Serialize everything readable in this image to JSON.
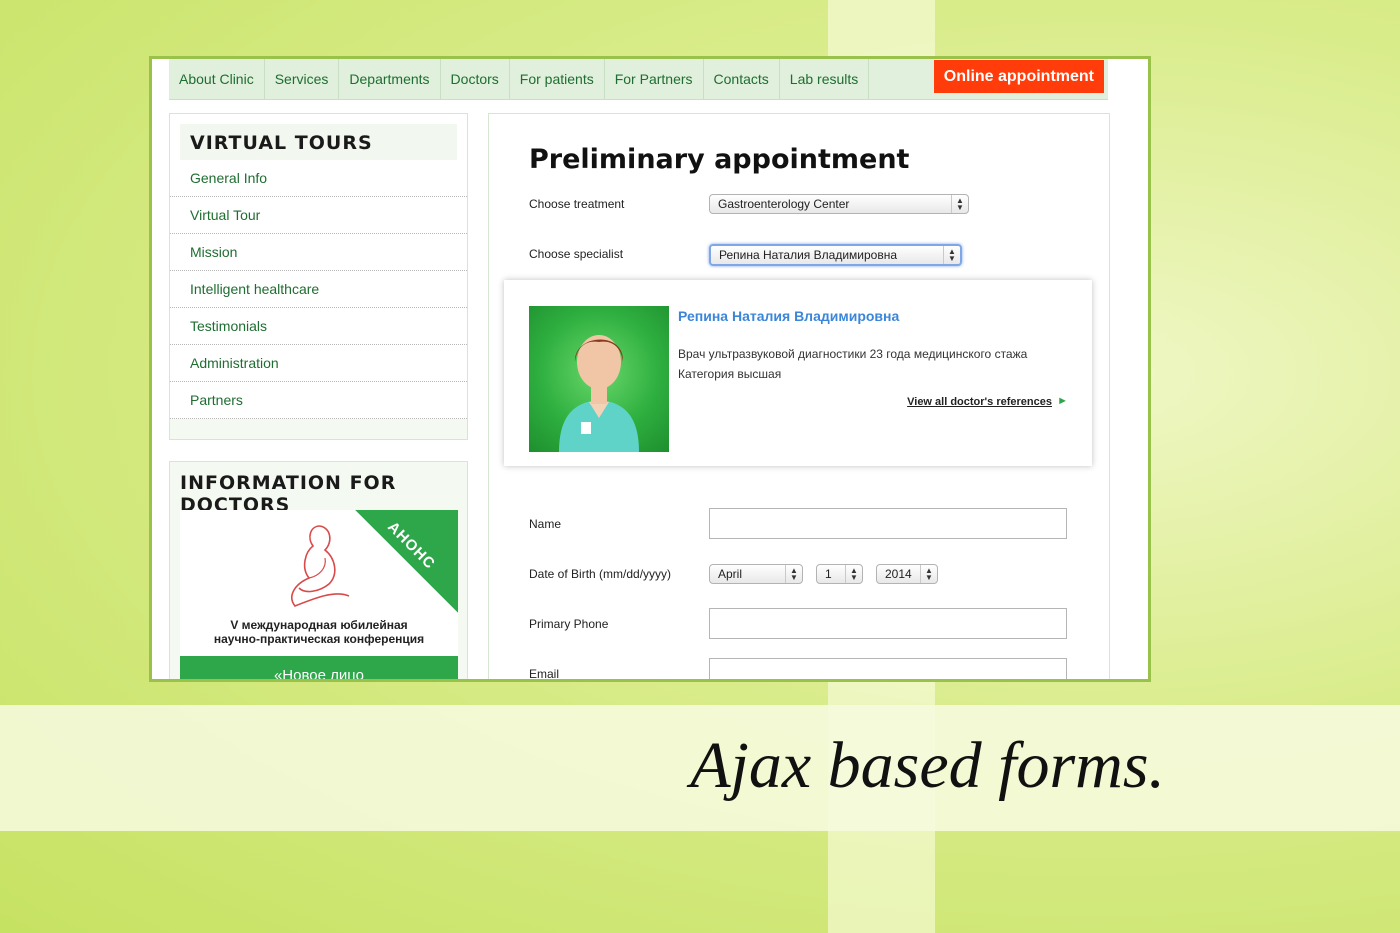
{
  "nav": {
    "items": [
      "About Clinic",
      "Services",
      "Departments",
      "Doctors",
      "For patients",
      "For Partners",
      "Contacts",
      "Lab results"
    ],
    "cta": "Online appointment"
  },
  "sidebar": {
    "tours_title": "VIRTUAL TOURS",
    "tours": [
      "General Info",
      "Virtual Tour",
      "Mission",
      "Intelligent healthcare",
      "Testimonials",
      "Administration",
      "Partners"
    ],
    "info_title": "INFORMATION FOR DOCTORS",
    "banner": {
      "ribbon": "АНОНС",
      "line1": "V международная юбилейная",
      "line2": "научно-практическая конференция",
      "foot": "«Новое лицо"
    }
  },
  "form": {
    "title": "Preliminary appointment",
    "treatment_label": "Choose treatment",
    "treatment_value": "Gastroenterology Center",
    "specialist_label": "Choose specialist",
    "specialist_value": "Репина Наталия Владимировна",
    "doctor": {
      "name": "Репина Наталия Владимировна",
      "desc1": "Врач ультразвуковой диагностики 23 года медицинского стажа",
      "desc2": "Категория высшая",
      "link": "View all doctor's references"
    },
    "name_label": "Name",
    "dob_label": "Date of Birth (mm/dd/yyyy)",
    "dob_month": "April",
    "dob_day": "1",
    "dob_year": "2014",
    "phone_label": "Primary Phone",
    "email_label": "Email"
  },
  "tagline": "Ajax based forms.",
  "colors": {
    "accent": "#ff3c0a",
    "nav_bg": "#e0f0dc",
    "link_green": "#1f6d31",
    "frame": "#9ac24b"
  }
}
